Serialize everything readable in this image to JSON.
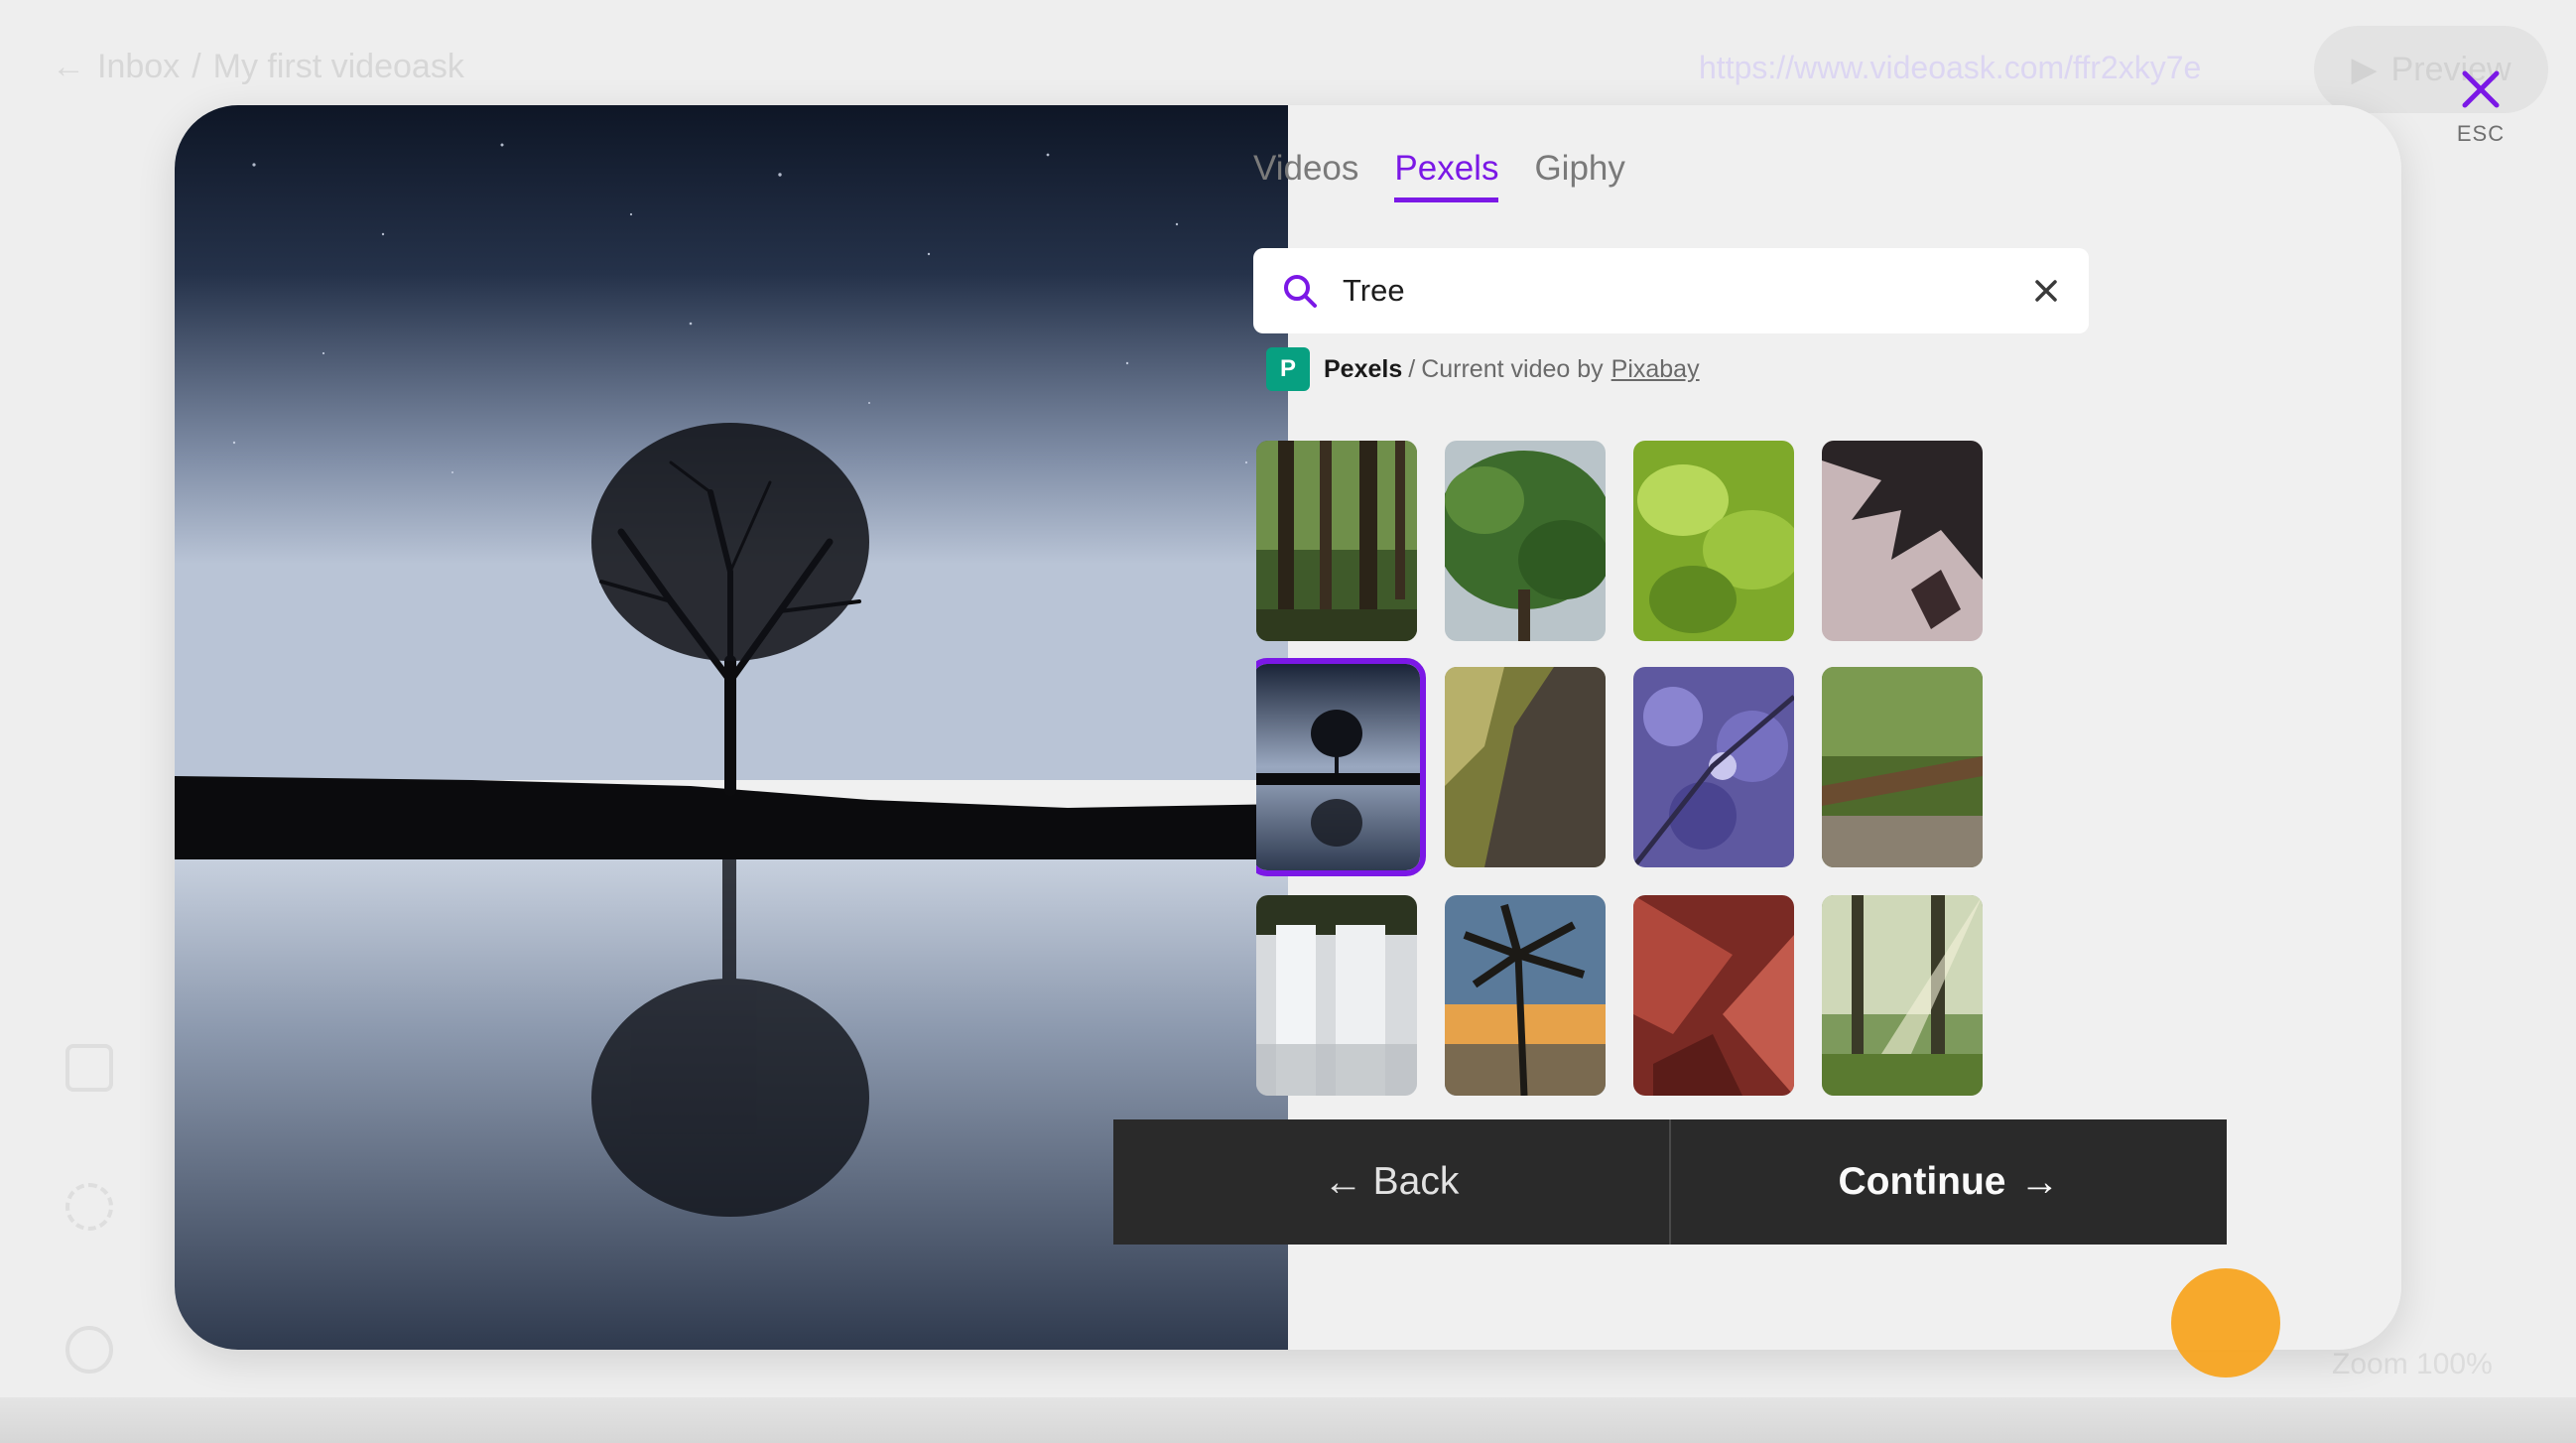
{
  "background": {
    "breadcrumb": {
      "back": "Inbox",
      "separator": "/",
      "title": "My first videoask"
    },
    "share_url": "https://www.videoask.com/ffr2xky7e",
    "preview_label": "Preview",
    "zoom_label": "Zoom 100%"
  },
  "close": {
    "label": "ESC"
  },
  "tabs": [
    {
      "label": "Videos"
    },
    {
      "label": "Pexels"
    },
    {
      "label": "Giphy"
    }
  ],
  "active_tab": "Pexels",
  "search": {
    "value": "Tree",
    "placeholder": "Search"
  },
  "attribution": {
    "brand": "Pexels",
    "separator": "/",
    "text": "Current video by",
    "author": "Pixabay"
  },
  "thumbnails": [
    {
      "name": "forest-trunks",
      "selected": false
    },
    {
      "name": "green-canopy",
      "selected": false
    },
    {
      "name": "green-leaves",
      "selected": false
    },
    {
      "name": "maple-silhouette",
      "selected": false
    },
    {
      "name": "lone-tree-lake",
      "selected": true
    },
    {
      "name": "tree-bark",
      "selected": false
    },
    {
      "name": "purple-blossoms",
      "selected": false
    },
    {
      "name": "jungle-creek",
      "selected": false
    },
    {
      "name": "waterfall",
      "selected": false
    },
    {
      "name": "palm-sunset",
      "selected": false
    },
    {
      "name": "red-leaves",
      "selected": false
    },
    {
      "name": "sunlit-forest",
      "selected": false
    }
  ],
  "footer": {
    "back_label": "Back",
    "continue_label": "Continue"
  },
  "colors": {
    "accent": "#7b18e6",
    "footer": "#2a2a2a",
    "pexels": "#07a081",
    "cursor": "#f7a31b"
  },
  "icons": {
    "search": "search-icon",
    "clear": "close-icon",
    "close": "close-icon",
    "back": "arrow-left-icon",
    "continue": "arrow-right-icon"
  }
}
